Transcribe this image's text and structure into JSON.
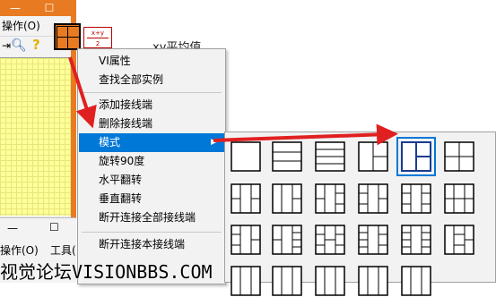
{
  "left_window": {
    "menu_ops": "操作(O)",
    "help_icon": "help-icon",
    "search_icon": "search-icon",
    "min_icon": "minimize-icon",
    "max_icon": "maximize-icon"
  },
  "subvi_icon": {
    "formula_text": "x+y\n2"
  },
  "background_label": "xy平均值",
  "context_menu": {
    "items": [
      {
        "label": "VI属性"
      },
      {
        "label": "查找全部实例"
      },
      {
        "label": "添加接线端"
      },
      {
        "label": "删除接线端"
      },
      {
        "label": "模式",
        "selected": true,
        "submenu": true
      },
      {
        "label": "旋转90度"
      },
      {
        "label": "水平翻转"
      },
      {
        "label": "垂直翻转"
      },
      {
        "label": "断开连接全部接线端"
      },
      {
        "label": "断开连接本接线端"
      }
    ]
  },
  "pattern_palette": {
    "selected_index": 4,
    "count_visible": 23
  },
  "bottom_window": {
    "menu_ops": "操作(O)",
    "menu_tools": "工具("
  },
  "watermark": "视觉论坛VISIONBBS.COM",
  "colors": {
    "accent": "#0078d7",
    "labview_orange": "#e87b22",
    "arrow_red": "#e02020"
  }
}
